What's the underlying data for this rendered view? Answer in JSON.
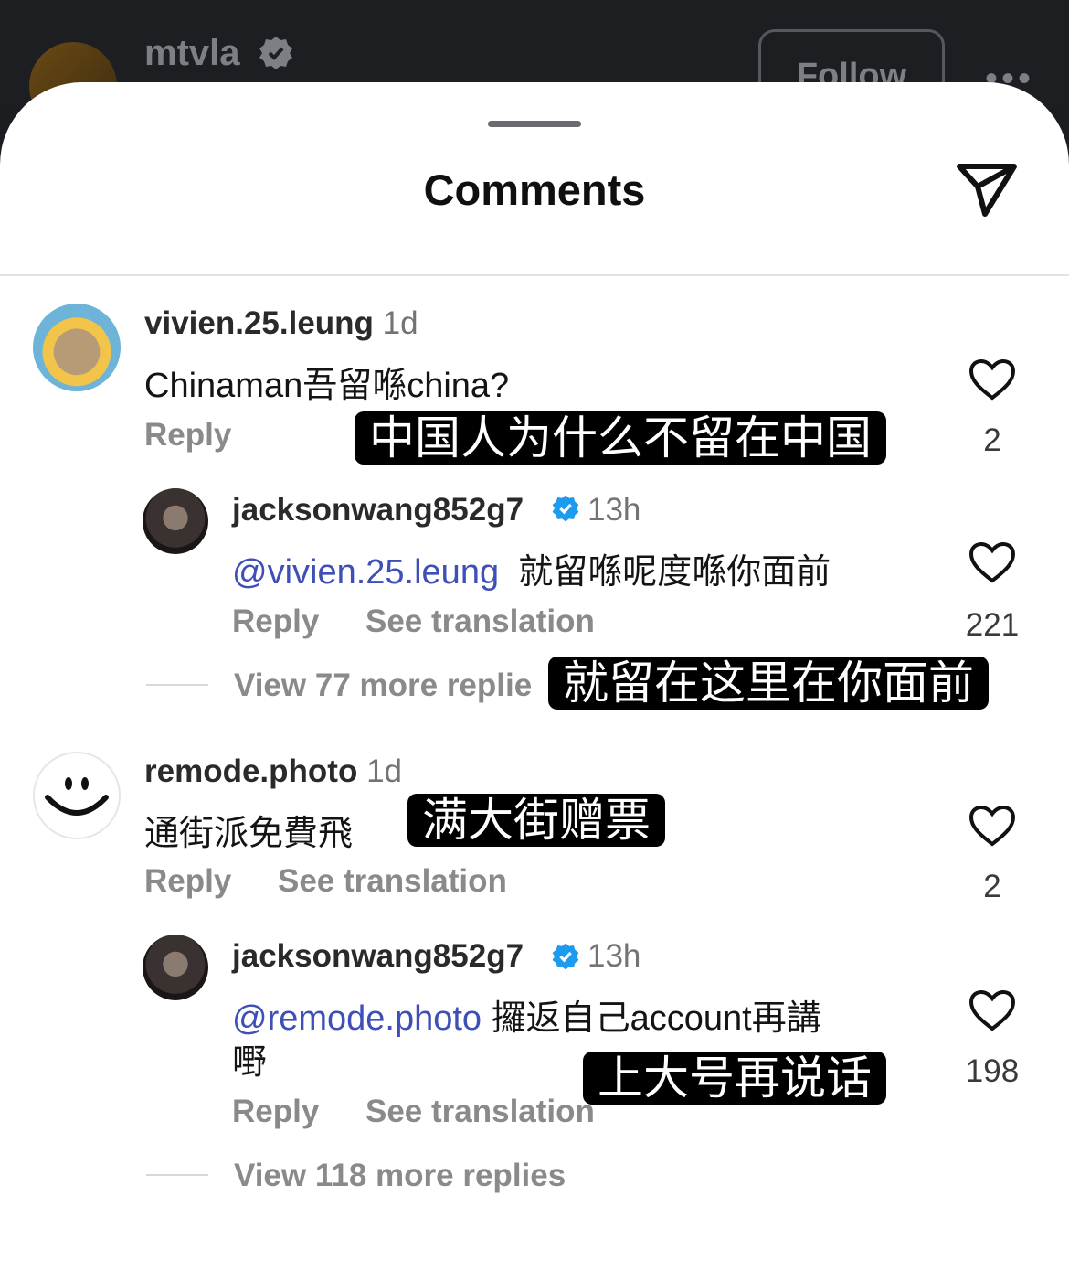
{
  "post": {
    "username": "mtvla",
    "follow_label": "Follow",
    "more_label": "•••"
  },
  "sheet": {
    "title": "Comments"
  },
  "comments": [
    {
      "username": "vivien.25.leung",
      "time": "1d",
      "text": "Chinaman吾留喺china?",
      "reply_label": "Reply",
      "likes": "2",
      "overlay": "中国人为什么不留在中国",
      "reply": {
        "username": "jacksonwang852g7",
        "time": "13h",
        "mention": "@vivien.25.leung",
        "text": "就留喺呢度喺你面前",
        "reply_label": "Reply",
        "translate_label": "See translation",
        "likes": "221",
        "overlay": "就留在这里在你面前"
      },
      "view_replies": "View 77 more replie"
    },
    {
      "username": "remode.photo",
      "time": "1d",
      "text": "通街派免費飛",
      "reply_label": "Reply",
      "translate_label": "See translation",
      "likes": "2",
      "overlay": "满大街赠票",
      "reply": {
        "username": "jacksonwang852g7",
        "time": "13h",
        "mention": "@remode.photo",
        "text": "攞返自己account再講",
        "text2": "嘢",
        "reply_label": "Reply",
        "translate_label": "See translation",
        "likes": "198",
        "overlay": "上大号再说话"
      },
      "view_replies": "View 118 more replies"
    }
  ],
  "colors": {
    "mention": "#3e4fb8",
    "verified": "#1d9bf0",
    "overlay_bg": "#000000"
  }
}
